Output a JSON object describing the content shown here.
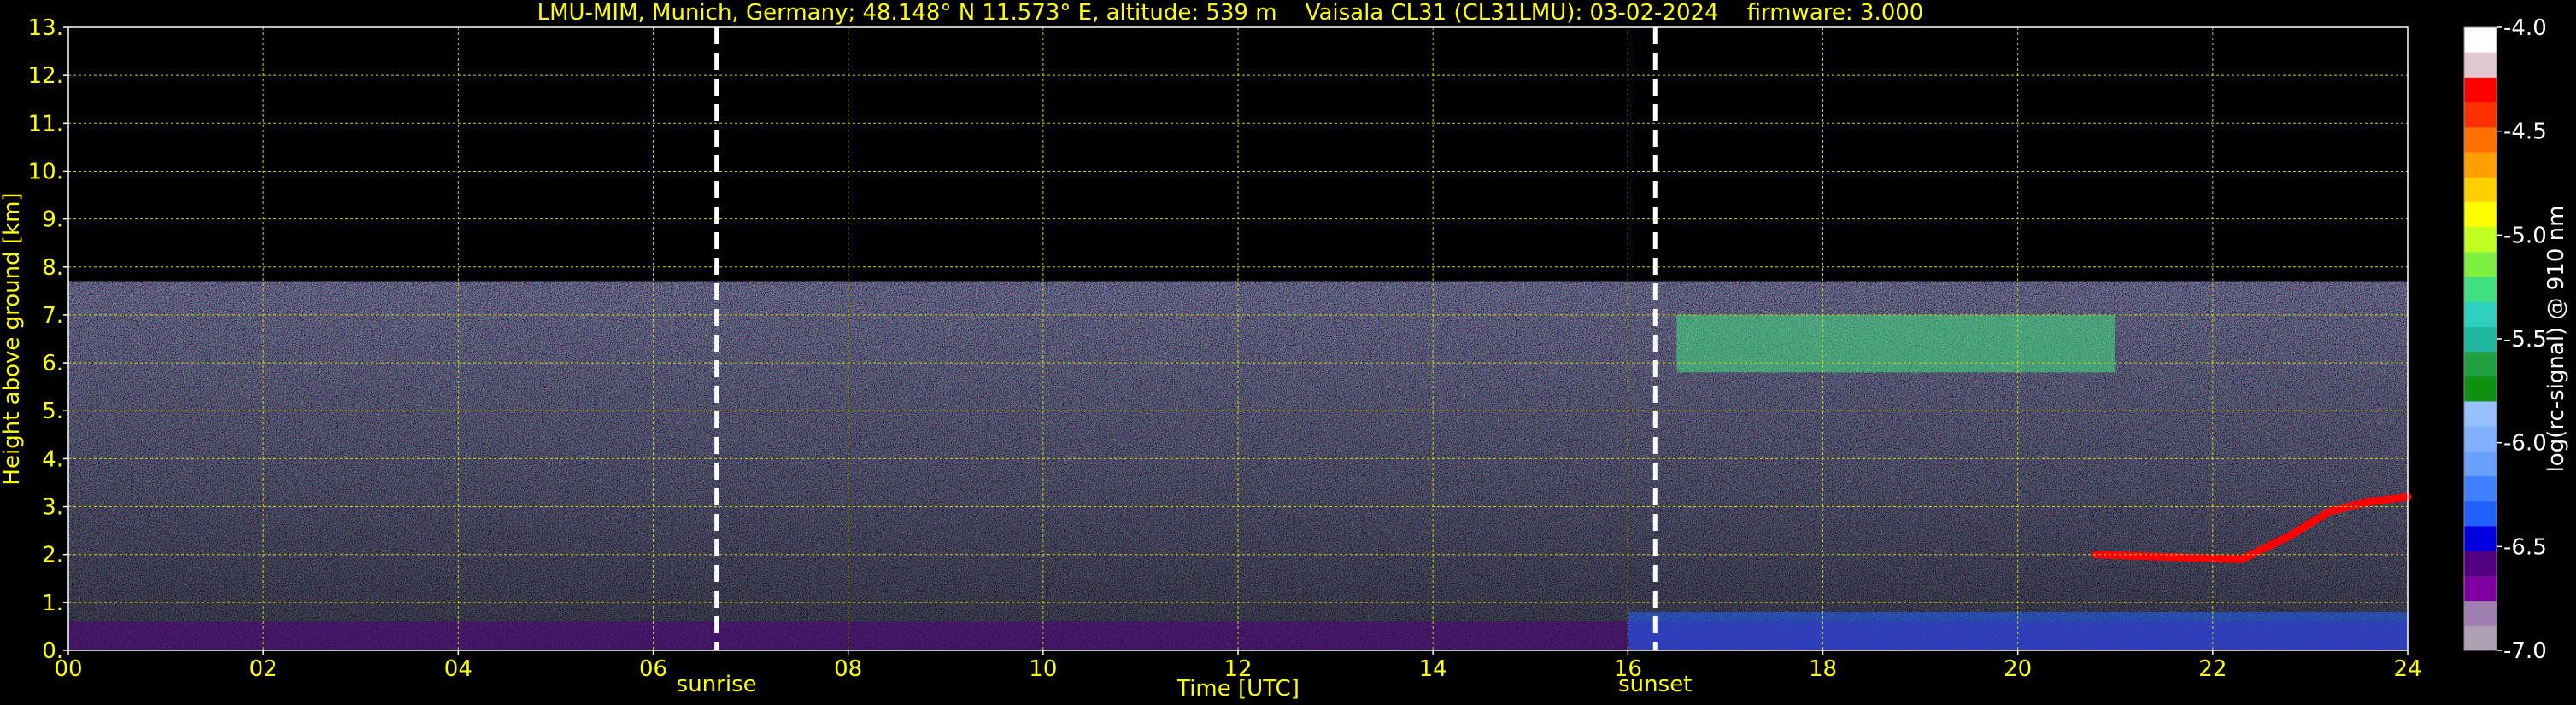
{
  "title": "LMU-MIM, Munich, Germany; 48.148° N 11.573° E, altitude: 539 m    Vaisala CL31 (CL31LMU): 03-02-2024    firmware: 3.000",
  "chart_data": {
    "type": "heatmap",
    "xlabel": "Time [UTC]",
    "ylabel": "Height above ground [km]",
    "xlim": [
      0,
      24
    ],
    "ylim": [
      0,
      13
    ],
    "x_ticks": [
      "00",
      "02",
      "04",
      "06",
      "08",
      "10",
      "12",
      "14",
      "16",
      "18",
      "20",
      "22",
      "24"
    ],
    "x_tick_values": [
      0,
      2,
      4,
      6,
      8,
      10,
      12,
      14,
      16,
      18,
      20,
      22,
      24
    ],
    "y_ticks": [
      "0.",
      "1.",
      "2.",
      "3.",
      "4.",
      "5.",
      "6.",
      "7.",
      "8.",
      "9.",
      "10.",
      "11.",
      "12.",
      "13."
    ],
    "y_tick_values": [
      0,
      1,
      2,
      3,
      4,
      5,
      6,
      7,
      8,
      9,
      10,
      11,
      12,
      13
    ],
    "grid": true,
    "data_top_km": 7.7,
    "markers": [
      {
        "label": "sunrise",
        "time": 6.65
      },
      {
        "label": "sunset",
        "time": 16.28
      }
    ],
    "colorbar": {
      "label": "log(rc-signal) @ 910 nm",
      "range": [
        -7.0,
        -4.0
      ],
      "ticks": [
        "-4.0",
        "-4.5",
        "-5.0",
        "-5.5",
        "-6.0",
        "-6.5",
        "-7.0"
      ],
      "tick_values": [
        -4.0,
        -4.5,
        -5.0,
        -5.5,
        -6.0,
        -6.5,
        -7.0
      ],
      "colors": [
        "#b0a0b4",
        "#a080b0",
        "#8000a0",
        "#500080",
        "#0000e0",
        "#2060ff",
        "#4080ff",
        "#6aa0ff",
        "#80b0ff",
        "#98c0ff",
        "#109010",
        "#20a040",
        "#20b8a0",
        "#30d0c0",
        "#40e080",
        "#80f040",
        "#c0ff20",
        "#ffff00",
        "#ffd000",
        "#ffa000",
        "#ff7000",
        "#ff3000",
        "#ff0000",
        "#e0c8d0",
        "#ffffff"
      ]
    },
    "features": [
      {
        "name": "surface aerosol layer",
        "time": [
          0,
          24
        ],
        "height_km": [
          0,
          0.6
        ],
        "log_signal": -6.6
      },
      {
        "name": "boundary layer",
        "time": [
          16,
          24
        ],
        "height_km": [
          0,
          0.8
        ],
        "log_signal": -6.4
      },
      {
        "name": "high cloud",
        "time": [
          16.5,
          21
        ],
        "height_km": [
          5.8,
          7.0
        ],
        "log_signal": -5.2
      },
      {
        "name": "low cloud",
        "time": [
          20.8,
          24
        ],
        "height_km": [
          1.7,
          3.3
        ],
        "log_signal": -4.2
      }
    ]
  }
}
